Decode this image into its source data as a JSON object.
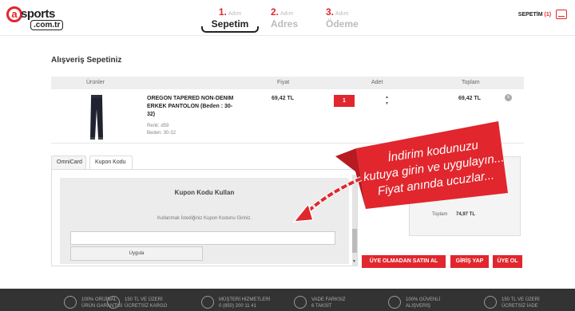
{
  "header": {
    "logo_brand": "sports",
    "logo_letter": "a",
    "logo_domain": ".com.tr",
    "steps": [
      {
        "num": "1.",
        "adim": "Adım",
        "name": "Sepetim"
      },
      {
        "num": "2.",
        "adim": "Adım",
        "name": "Adres"
      },
      {
        "num": "3.",
        "adim": "Adım",
        "name": "Ödeme"
      }
    ],
    "cart_label": "SEPETİM",
    "cart_count": "(1)"
  },
  "page_title": "Alışveriş Sepetiniz",
  "table": {
    "headers": {
      "product": "Ürünler",
      "price": "Fiyat",
      "qty": "Adet",
      "total": "Toplam"
    },
    "item": {
      "name": "OREGON TAPERED NON-DENIM ERKEK PANTOLON (Beden : 30-32)",
      "color": "Renk: d59",
      "size": "Beden: 30-32",
      "price": "69,42 TL",
      "quantity": "1",
      "total": "69,42 TL",
      "remove": "x"
    }
  },
  "tabs": {
    "omnicard": "OmniCard",
    "coupon": "Kupon Kodu"
  },
  "coupon": {
    "title": "Kupon Kodu Kullan",
    "description": "Kullanmak İstediğiniz Kupon Kodunu Giriniz.",
    "input_value": "",
    "apply": "Uygula"
  },
  "summary": {
    "total_label": "Toplam",
    "total_value": "74,97 TL"
  },
  "buttons": {
    "guest": "ÜYE OLMADAN SATIN AL",
    "login": "GİRİŞ YAP",
    "register": "ÜYE OL"
  },
  "promo": {
    "line1": "İndirim kodunuzu",
    "line2": "kutuya girin ve uygulayın...",
    "line3": "Fiyat anında ucuzlar..."
  },
  "footer": [
    {
      "line1": "100% ORİJİNAL",
      "line2": "ÜRÜN GARANTİSİ"
    },
    {
      "line1": "150 TL VE ÜZERİ",
      "line2": "ÜCRETSİZ KARGO"
    },
    {
      "line1": "MÜŞTERİ HİZMETLERİ",
      "line2": "0 (850) 200 11 41"
    },
    {
      "line1": "VADE FARKSIZ",
      "line2": "6 TAKSİT"
    },
    {
      "line1": "100% GÜVENLİ",
      "line2": "ALIŞVERİŞ"
    },
    {
      "line1": "150 TL VE ÜZERİ",
      "line2": "ÜCRETSİZ İADE"
    }
  ],
  "colors": {
    "accent": "#e1262d",
    "footer": "#333333"
  }
}
